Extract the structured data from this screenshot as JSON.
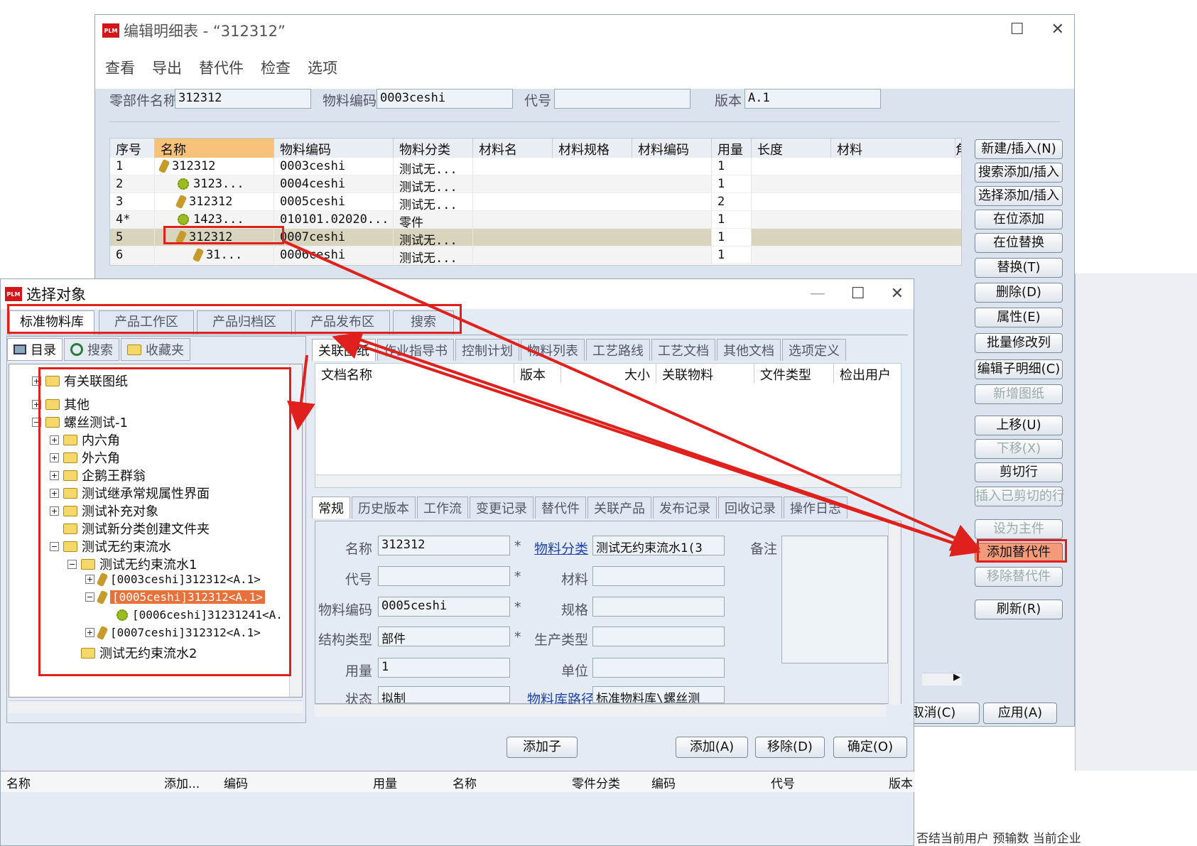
{
  "main_window": {
    "title": "编辑明细表 - “312312”",
    "menu": [
      "查看",
      "导出",
      "替代件",
      "检查",
      "选项"
    ],
    "fields": {
      "part_name_label": "零部件名称",
      "part_name": "312312",
      "material_code_label": "物料编码",
      "material_code": "0003ceshi",
      "code_label": "代号",
      "code": "",
      "version_label": "版本",
      "version": "A.1"
    },
    "table": {
      "headers": [
        "序号",
        "名称",
        "物料编码",
        "物料分类",
        "材料名",
        "材料规格",
        "材料编码",
        "用量",
        "长度",
        "材料",
        "角"
      ],
      "rows": [
        {
          "seq": "1",
          "name": "312312",
          "code": "0003ceshi",
          "cat": "测试无...",
          "qty": "1"
        },
        {
          "seq": "2",
          "name": "3123...",
          "code": "0004ceshi",
          "cat": "测试无...",
          "qty": "1"
        },
        {
          "seq": "3",
          "name": "312312",
          "code": "0005ceshi",
          "cat": "测试无...",
          "qty": "2"
        },
        {
          "seq": "4*",
          "name": "1423...",
          "code": "010101.02020...",
          "cat": "零件",
          "qty": "1"
        },
        {
          "seq": "5",
          "name": "312312",
          "code": "0007ceshi",
          "cat": "测试无...",
          "qty": "1"
        },
        {
          "seq": "6",
          "name": "31...",
          "code": "0006ceshi",
          "cat": "测试无...",
          "qty": "1"
        }
      ]
    },
    "side_buttons": [
      "新建/插入(N)",
      "搜索添加/插入",
      "选择添加/插入",
      "在位添加",
      "在位替换",
      "替换(T)",
      "删除(D)",
      "属性(E)",
      "批量修改列",
      "编辑子明细(C)",
      "新增图纸",
      "上移(U)",
      "下移(X)",
      "剪切行",
      "插入已剪切的行",
      "设为主件",
      "添加替代件",
      "移除替代件",
      "刷新(R)"
    ],
    "bottom_buttons": [
      "取消(C)",
      "应用(A)"
    ]
  },
  "dialog": {
    "title": "选择对象",
    "tabs": [
      "标准物料库",
      "产品工作区",
      "产品归档区",
      "产品发布区",
      "搜索"
    ],
    "left_tabs": [
      "目录",
      "搜索",
      "收藏夹"
    ],
    "tree": [
      "有关联图纸",
      "其他",
      "螺丝测试-1",
      "内六角",
      "外六角",
      "企鹅王群翁",
      "测试继承常规属性界面",
      "测试补充对象",
      "测试新分类创建文件夹",
      "测试无约束流水",
      "测试无约束流水1",
      "[0003ceshi]312312<A.1>",
      "[0005ceshi]312312<A.1>",
      "[0006ceshi]31231241<A.",
      "[0007ceshi]312312<A.1>",
      "测试无约束流水2"
    ],
    "doc_tabs": [
      "关联图纸",
      "作业指导书",
      "控制计划",
      "物料列表",
      "工艺路线",
      "工艺文档",
      "其他文档",
      "选项定义"
    ],
    "doc_headers": [
      "文档名称",
      "版本",
      "大小",
      "关联物料",
      "文件类型",
      "检出用户"
    ],
    "prop_tabs": [
      "常规",
      "历史版本",
      "工作流",
      "变更记录",
      "替代件",
      "关联产品",
      "发布记录",
      "回收记录",
      "操作日志"
    ],
    "props": {
      "name_label": "名称",
      "name": "312312",
      "category_label": "物料分类",
      "category": "测试无约束流水1(3",
      "remark_label": "备注",
      "code_label": "代号",
      "code": "",
      "material_label": "材料",
      "material": "",
      "mcode_label": "物料编码",
      "mcode": "0005ceshi",
      "spec_label": "规格",
      "spec": "",
      "struct_label": "结构类型",
      "struct": "部件",
      "prodtype_label": "生产类型",
      "prodtype": "",
      "qty_label": "用量",
      "qty": "1",
      "unit_label": "单位",
      "unit": "",
      "status_label": "状态",
      "status": "拟制",
      "path_label": "物料库路径",
      "path": "标准物料库\\螺丝测"
    },
    "buttons": {
      "add_child": "添加子",
      "add": "添加(A)",
      "remove": "移除(D)",
      "ok": "确定(O)"
    },
    "bottom_headers": [
      "名称",
      "添加...",
      "编码",
      "用量",
      "名称",
      "零件分类",
      "编码",
      "代号",
      "版本"
    ]
  },
  "background_text": "否结当前用户 预输数 当前企业"
}
